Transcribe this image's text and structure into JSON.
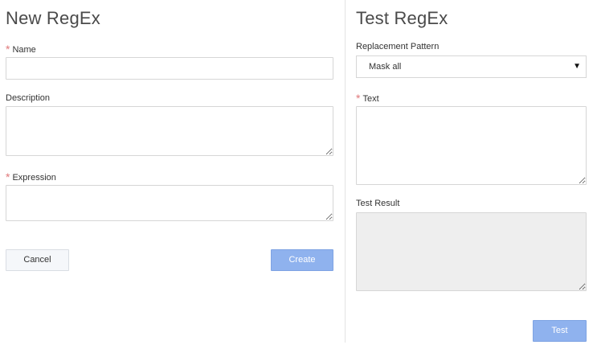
{
  "new_regex": {
    "title": "New RegEx",
    "name": {
      "label": "Name",
      "required": true,
      "value": ""
    },
    "description": {
      "label": "Description",
      "value": ""
    },
    "expression": {
      "label": "Expression",
      "required": true,
      "value": ""
    },
    "cancel_label": "Cancel",
    "create_label": "Create"
  },
  "test_regex": {
    "title": "Test RegEx",
    "replacement_pattern": {
      "label": "Replacement Pattern",
      "selected": "Mask all"
    },
    "text": {
      "label": "Text",
      "required": true,
      "value": ""
    },
    "test_result": {
      "label": "Test Result",
      "value": ""
    },
    "test_label": "Test"
  },
  "colors": {
    "required_star": "#e0787a",
    "primary_button": "#8fb2ee",
    "result_background": "#eeeeee"
  },
  "icons": {
    "required": "asterisk-icon",
    "select_caret": "caret-down-icon"
  }
}
